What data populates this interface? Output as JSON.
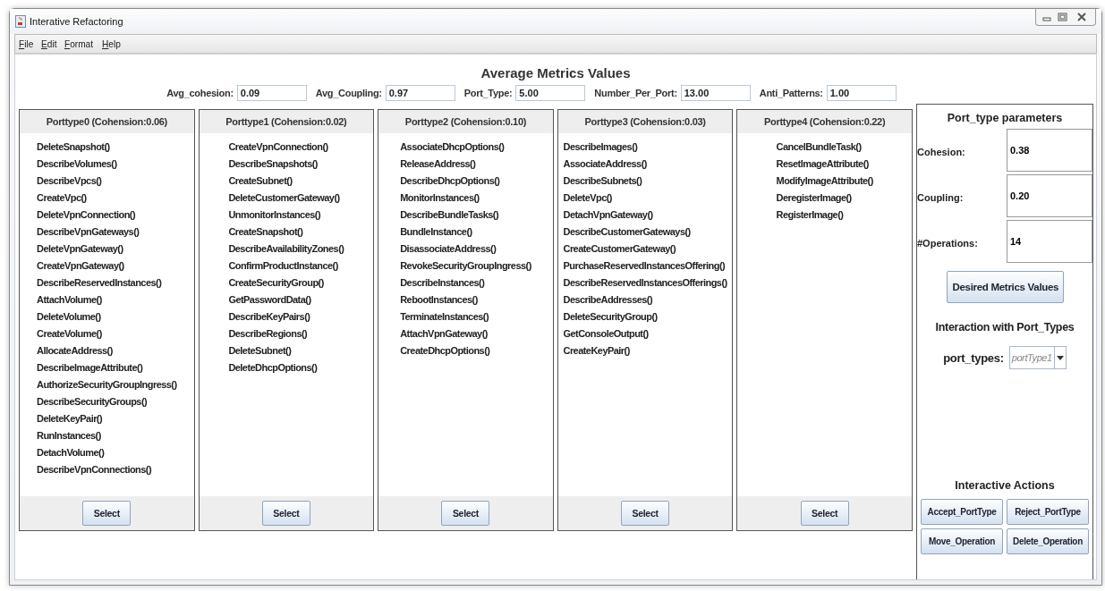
{
  "window": {
    "title": "Interative Refactoring"
  },
  "menu": [
    "File",
    "Edit",
    "Format",
    "Help"
  ],
  "metrics": {
    "title": "Average Metrics Values",
    "fields": [
      {
        "label": "Avg_cohesion:",
        "value": "0.09"
      },
      {
        "label": "Avg_Coupling:",
        "value": "0.97"
      },
      {
        "label": "Port_Type:",
        "value": "5.00"
      },
      {
        "label": "Number_Per_Port:",
        "value": "13.00"
      },
      {
        "label": "Anti_Patterns:",
        "value": "1.00"
      }
    ]
  },
  "port_types": [
    {
      "title": "Porttype0 (Cohension:0.06)",
      "operations": [
        "DeleteSnapshot()",
        "DescribeVolumes()",
        "DescribeVpcs()",
        "CreateVpc()",
        "DeleteVpnConnection()",
        "DescribeVpnGateways()",
        "DeleteVpnGateway()",
        "CreateVpnGateway()",
        "DescribeReservedInstances()",
        "AttachVolume()",
        "DeleteVolume()",
        "CreateVolume()",
        "AllocateAddress()",
        "DescribeImageAttribute()",
        "AuthorizeSecurityGroupIngress()",
        "DescribeSecurityGroups()",
        "DeleteKeyPair()",
        "RunInstances()",
        "DetachVolume()",
        "DescribeVpnConnections()"
      ],
      "button": "Select"
    },
    {
      "title": "Porttype1 (Cohension:0.02)",
      "operations": [
        "CreateVpnConnection()",
        "DescribeSnapshots()",
        "CreateSubnet()",
        "DeleteCustomerGateway()",
        "UnmonitorInstances()",
        "CreateSnapshot()",
        "DescribeAvailabilityZones()",
        "ConfirmProductInstance()",
        "CreateSecurityGroup()",
        "GetPasswordData()",
        "DescribeKeyPairs()",
        "DescribeRegions()",
        "DeleteSubnet()",
        "DeleteDhcpOptions()"
      ],
      "button": "Select"
    },
    {
      "title": "Porttype2 (Cohension:0.10)",
      "operations": [
        "AssociateDhcpOptions()",
        "ReleaseAddress()",
        "DescribeDhcpOptions()",
        "MonitorInstances()",
        "DescribeBundleTasks()",
        "BundleInstance()",
        "DisassociateAddress()",
        "RevokeSecurityGroupIngress()",
        "DescribeInstances()",
        "RebootInstances()",
        "TerminateInstances()",
        "AttachVpnGateway()",
        "CreateDhcpOptions()"
      ],
      "button": "Select"
    },
    {
      "title": "Porttype3 (Cohension:0.03)",
      "operations": [
        "DescribeImages()",
        "AssociateAddress()",
        "DescribeSubnets()",
        "DeleteVpc()",
        "DetachVpnGateway()",
        "DescribeCustomerGateways()",
        "CreateCustomerGateway()",
        "PurchaseReservedInstancesOffering()",
        "DescribeReservedInstancesOfferings()",
        "DescribeAddresses()",
        "DeleteSecurityGroup()",
        "GetConsoleOutput()",
        "CreateKeyPair()"
      ],
      "button": "Select"
    },
    {
      "title": "Porttype4 (Cohension:0.22)",
      "operations": [
        "CancelBundleTask()",
        "ResetImageAttribute()",
        "ModifyImageAttribute()",
        "DeregisterImage()",
        "RegisterImage()"
      ],
      "button": "Select"
    }
  ],
  "parameters": {
    "title": "Port_type parameters",
    "fields": [
      {
        "label": "Cohesion:",
        "value": "0.38"
      },
      {
        "label": "Coupling:",
        "value": "0.20"
      },
      {
        "label": "#Operations:",
        "value": "14"
      }
    ],
    "button": "Desired Metrics Values"
  },
  "interaction": {
    "title": "Interaction with Port_Types",
    "label": "port_types:",
    "value": "portType1"
  },
  "actions": {
    "title": "Interactive Actions",
    "buttons": [
      "Accept_PortType",
      "Reject_PortType",
      "Move_Operation",
      "Delete_Operation"
    ]
  }
}
